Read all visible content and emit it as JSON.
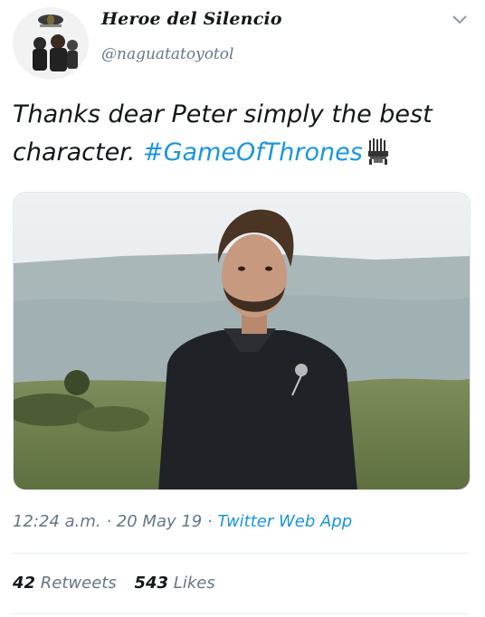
{
  "user": {
    "display_name": "Heroe del Silencio",
    "handle": "@naguatatoyotol",
    "avatar_icon": "profile-photo-group-avatar"
  },
  "header": {
    "menu_icon": "chevron-down-icon"
  },
  "tweet": {
    "text": "Thanks dear Peter simply the best character. ",
    "hashtag": "#GameOfThrones",
    "hashtag_icon": "iron-throne-icon",
    "media_description_icon": "photo-attachment"
  },
  "meta": {
    "time": "12:24 a.m.",
    "separator": " · ",
    "date": "20 May 19",
    "separator2": " · ",
    "source": "Twitter Web App"
  },
  "stats": {
    "retweets_count": "42",
    "retweets_label": "Retweets",
    "likes_count": "543",
    "likes_label": "Likes"
  },
  "colors": {
    "link": "#1b95e0",
    "secondary_text": "#657786",
    "primary_text": "#14171a",
    "divider": "#e6ecf0"
  }
}
